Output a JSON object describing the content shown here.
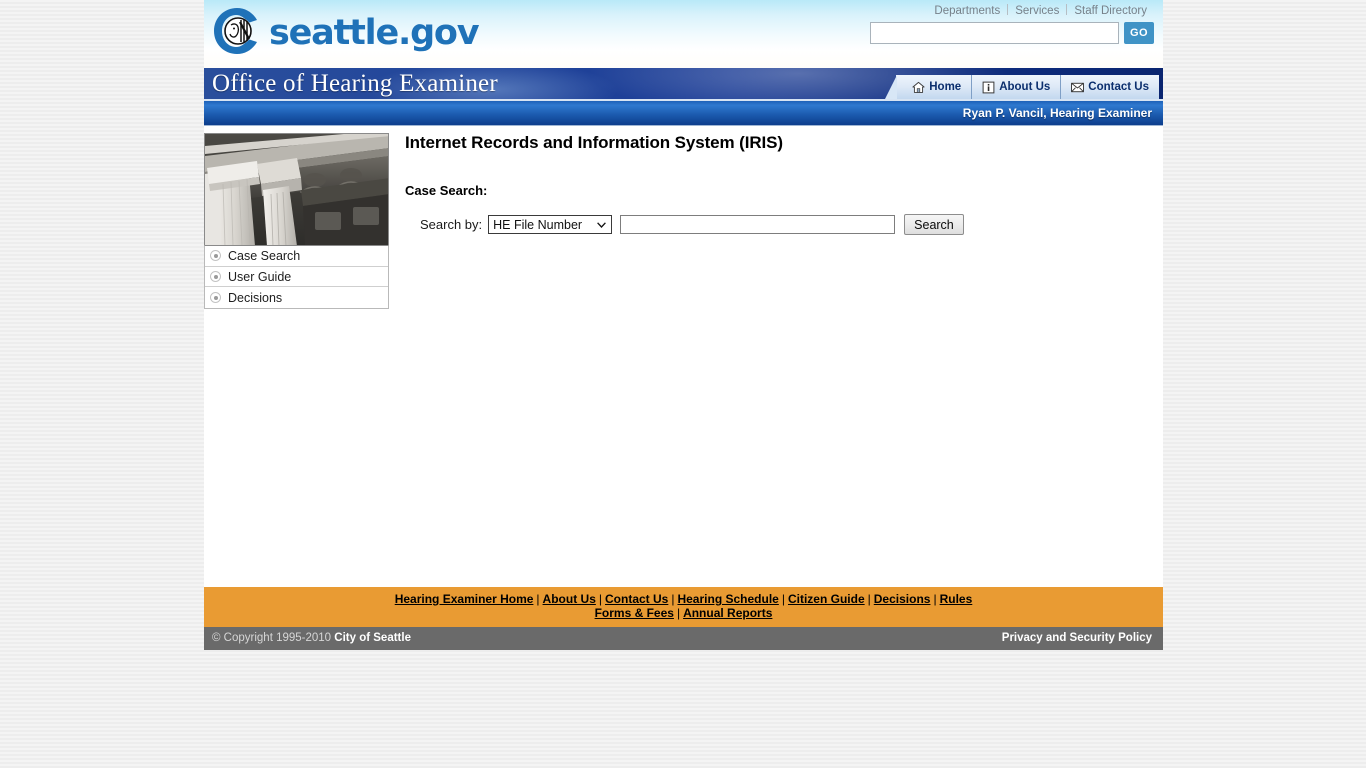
{
  "brand": {
    "logo_icon": "seattle-city-seal-icon",
    "wordmark": "seattle.gov"
  },
  "utility_nav": {
    "items": [
      {
        "label": "Departments"
      },
      {
        "label": "Services"
      },
      {
        "label": "Staff Directory"
      }
    ]
  },
  "site_search": {
    "value": "",
    "placeholder": "",
    "go_label": "GO",
    "go_color": "#3f93c6"
  },
  "banner": {
    "title": "Office of Hearing Examiner",
    "gradient_from": "#2a4f9c",
    "gradient_to": "#0a2570",
    "tabs": [
      {
        "label": "Home",
        "icon": "house-icon"
      },
      {
        "label": "About Us",
        "icon": "info-icon"
      },
      {
        "label": "Contact Us",
        "icon": "envelope-icon"
      }
    ]
  },
  "examiner_bar": {
    "name": "Ryan P. Vancil, Hearing Examiner",
    "color": "#1c5cb0"
  },
  "sidebar": {
    "photo_alt": "classical-columns-photo",
    "items": [
      {
        "label": "Case Search"
      },
      {
        "label": "User Guide"
      },
      {
        "label": "Decisions"
      }
    ]
  },
  "main": {
    "page_title": "Internet Records and Information System (IRIS)",
    "section_label": "Case Search:",
    "search_by_label": "Search by:",
    "search_by_selected": "HE File Number",
    "search_by_options": [
      "HE File Number"
    ],
    "query_value": "",
    "query_placeholder": "",
    "submit_label": "Search"
  },
  "footer": {
    "background": "#e99b33",
    "links_row_1": [
      "Hearing Examiner Home",
      "About Us",
      "Contact Us",
      "Hearing Schedule",
      "Citizen Guide",
      "Decisions",
      "Rules"
    ],
    "links_row_2": [
      "Forms & Fees",
      "Annual Reports"
    ],
    "separator": "|",
    "copyright_prefix": "© Copyright 1995-2010 ",
    "copyright_org": "City of Seattle",
    "privacy_link": "Privacy and Security Policy"
  }
}
